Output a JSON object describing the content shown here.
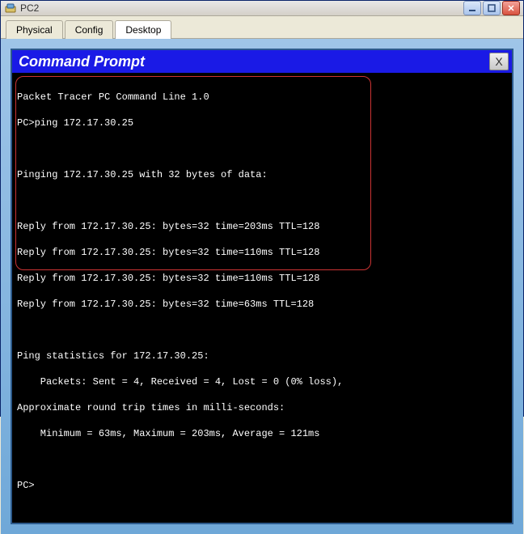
{
  "window": {
    "title": "PC2"
  },
  "tabs": {
    "physical": "Physical",
    "config": "Config",
    "desktop": "Desktop"
  },
  "cmd": {
    "title": "Command Prompt",
    "close_label": "X"
  },
  "terminal": {
    "banner": "Packet Tracer PC Command Line 1.0",
    "prompt1": "PC>ping 172.17.30.25",
    "blank1": " ",
    "pinging": "Pinging 172.17.30.25 with 32 bytes of data:",
    "blank2": " ",
    "reply1": "Reply from 172.17.30.25: bytes=32 time=203ms TTL=128",
    "reply2": "Reply from 172.17.30.25: bytes=32 time=110ms TTL=128",
    "reply3": "Reply from 172.17.30.25: bytes=32 time=110ms TTL=128",
    "reply4": "Reply from 172.17.30.25: bytes=32 time=63ms TTL=128",
    "blank3": " ",
    "stats_header": "Ping statistics for 172.17.30.25:",
    "stats_packets": "    Packets: Sent = 4, Received = 4, Lost = 0 (0% loss),",
    "rtt_header": "Approximate round trip times in milli-seconds:",
    "rtt_values": "    Minimum = 63ms, Maximum = 203ms, Average = 121ms",
    "blank4": " ",
    "prompt2": "PC>"
  }
}
